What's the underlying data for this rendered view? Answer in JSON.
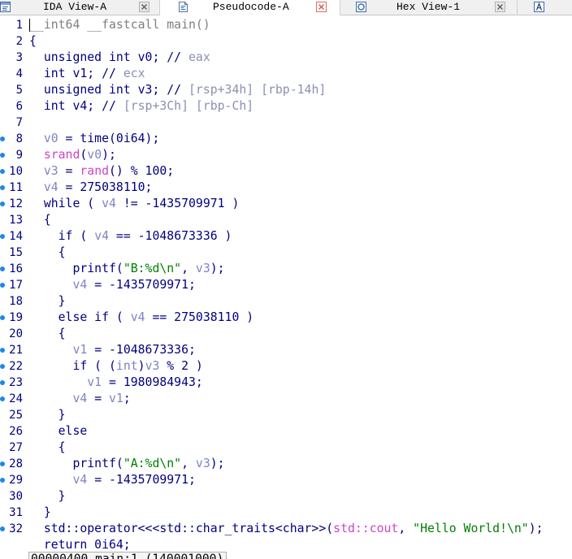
{
  "tabs": [
    {
      "label": "IDA View-A",
      "icon": "ida-view-icon",
      "active": false
    },
    {
      "label": "Pseudocode-A",
      "icon": "pseudocode-icon",
      "active": true
    },
    {
      "label": "Hex View-1",
      "icon": "hex-view-icon",
      "active": false
    },
    {
      "icon": "structures-icon",
      "active": false
    }
  ],
  "colors": {
    "default": "#000080",
    "marker": "#1e88e5"
  },
  "code": {
    "lines": [
      {
        "n": "1",
        "cursor": true,
        "tokens": [
          [
            "__int64 __fastcall main()",
            "#7f7f7f"
          ]
        ]
      },
      {
        "n": "2",
        "tokens": [
          [
            "{"
          ]
        ]
      },
      {
        "n": "3",
        "tokens": [
          [
            "  unsigned int v0; // "
          ],
          [
            "eax",
            "#8a8fb5"
          ]
        ]
      },
      {
        "n": "4",
        "tokens": [
          [
            "  int v1; // "
          ],
          [
            "ecx",
            "#8a8fb5"
          ]
        ]
      },
      {
        "n": "5",
        "tokens": [
          [
            "  unsigned int v3; // "
          ],
          [
            "[rsp+34h] [rbp-14h]",
            "#8a8fb5"
          ]
        ]
      },
      {
        "n": "6",
        "tokens": [
          [
            "  int v4; // "
          ],
          [
            "[rsp+3Ch] [rbp-Ch]",
            "#8a8fb5"
          ]
        ]
      },
      {
        "n": "7",
        "tokens": []
      },
      {
        "n": "8",
        "marker": true,
        "tokens": [
          [
            "  v0",
            "#7d85c2"
          ],
          [
            " = time(0i64);"
          ]
        ]
      },
      {
        "n": "9",
        "marker": true,
        "tokens": [
          [
            "  srand",
            "#cc44cc"
          ],
          [
            "("
          ],
          [
            "v0",
            "#7d85c2"
          ],
          [
            ");"
          ]
        ]
      },
      {
        "n": "10",
        "marker": true,
        "tokens": [
          [
            "  v3",
            "#7d85c2"
          ],
          [
            " = "
          ],
          [
            "rand",
            "#cc44cc"
          ],
          [
            "() % 100;"
          ]
        ]
      },
      {
        "n": "11",
        "marker": true,
        "tokens": [
          [
            "  v4",
            "#7d85c2"
          ],
          [
            " = 275038110;"
          ]
        ]
      },
      {
        "n": "12",
        "marker": true,
        "tokens": [
          [
            "  while ( "
          ],
          [
            "v4",
            "#7d85c2"
          ],
          [
            " != -1435709971 )"
          ]
        ]
      },
      {
        "n": "13",
        "tokens": [
          [
            "  {"
          ]
        ]
      },
      {
        "n": "14",
        "marker": true,
        "tokens": [
          [
            "    if ( "
          ],
          [
            "v4",
            "#7d85c2"
          ],
          [
            " == -1048673336 )"
          ]
        ]
      },
      {
        "n": "15",
        "tokens": [
          [
            "    {"
          ]
        ]
      },
      {
        "n": "16",
        "marker": true,
        "tokens": [
          [
            "      printf("
          ],
          [
            "\"B:%d\\n\"",
            "#008000"
          ],
          [
            ", "
          ],
          [
            "v3",
            "#7d85c2"
          ],
          [
            ");"
          ]
        ]
      },
      {
        "n": "17",
        "marker": true,
        "tokens": [
          [
            "      v4",
            "#7d85c2"
          ],
          [
            " = -1435709971;"
          ]
        ]
      },
      {
        "n": "18",
        "tokens": [
          [
            "    }"
          ]
        ]
      },
      {
        "n": "19",
        "marker": true,
        "tokens": [
          [
            "    else if ( "
          ],
          [
            "v4",
            "#7d85c2"
          ],
          [
            " == 275038110 )"
          ]
        ]
      },
      {
        "n": "20",
        "tokens": [
          [
            "    {"
          ]
        ]
      },
      {
        "n": "21",
        "marker": true,
        "tokens": [
          [
            "      v1",
            "#7d85c2"
          ],
          [
            " = -1048673336;"
          ]
        ]
      },
      {
        "n": "22",
        "marker": true,
        "tokens": [
          [
            "      if ( ("
          ],
          [
            "int",
            "#7d85c2"
          ],
          [
            ")"
          ],
          [
            "v3",
            "#7d85c2"
          ],
          [
            " % 2 )"
          ]
        ]
      },
      {
        "n": "23",
        "marker": true,
        "tokens": [
          [
            "        v1",
            "#7d85c2"
          ],
          [
            " = 1980984943;"
          ]
        ]
      },
      {
        "n": "24",
        "marker": true,
        "tokens": [
          [
            "      v4",
            "#7d85c2"
          ],
          [
            " = "
          ],
          [
            "v1",
            "#7d85c2"
          ],
          [
            ";"
          ]
        ]
      },
      {
        "n": "25",
        "tokens": [
          [
            "    }"
          ]
        ]
      },
      {
        "n": "26",
        "tokens": [
          [
            "    else"
          ]
        ]
      },
      {
        "n": "27",
        "tokens": [
          [
            "    {"
          ]
        ]
      },
      {
        "n": "28",
        "marker": true,
        "tokens": [
          [
            "      printf("
          ],
          [
            "\"A:%d\\n\"",
            "#008000"
          ],
          [
            ", "
          ],
          [
            "v3",
            "#7d85c2"
          ],
          [
            ");"
          ]
        ]
      },
      {
        "n": "29",
        "marker": true,
        "tokens": [
          [
            "      v4",
            "#7d85c2"
          ],
          [
            " = -1435709971;"
          ]
        ]
      },
      {
        "n": "30",
        "tokens": [
          [
            "    }"
          ]
        ]
      },
      {
        "n": "31",
        "tokens": [
          [
            "  }"
          ]
        ]
      },
      {
        "n": "32",
        "marker": true,
        "tokens": [
          [
            "  std::operator<<<std::char_traits<char>>("
          ],
          [
            "std::cout",
            "#cc44cc"
          ],
          [
            ", "
          ],
          [
            "\"Hello World!\\n\"",
            "#008000"
          ],
          [
            ");"
          ]
        ]
      },
      {
        "tokens": [
          [
            "  return 0i64;"
          ]
        ]
      }
    ]
  },
  "status": {
    "location": "00000400 main:1 (140001000)"
  }
}
